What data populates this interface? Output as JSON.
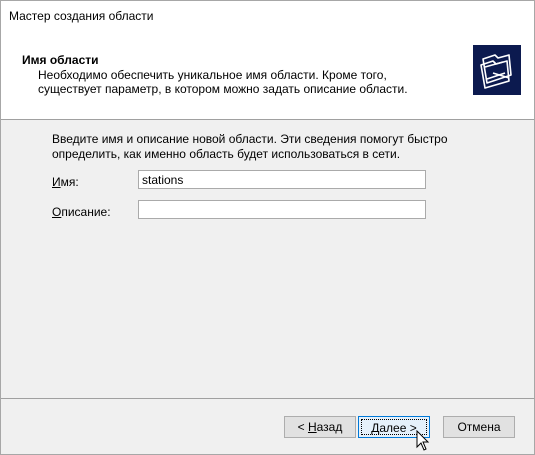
{
  "window": {
    "title": "Мастер создания области"
  },
  "header": {
    "title": "Имя области",
    "description": "Необходимо обеспечить уникальное имя области. Кроме того, существует параметр, в котором можно задать описание области.",
    "icon": "folders-icon",
    "icon_bg": "#0c1a4f"
  },
  "body": {
    "instructions": "Введите имя и описание новой области. Эти сведения помогут быстро определить, как именно область будет использоваться в сети.",
    "name_field": {
      "label_accel": "И",
      "label_rest": "мя:",
      "value": "stations"
    },
    "description_field": {
      "label_accel": "О",
      "label_rest": "писание:",
      "value": ""
    }
  },
  "buttons": {
    "back": {
      "prefix": "< ",
      "accel": "Н",
      "rest": "азад"
    },
    "next": {
      "accel": "Д",
      "rest": "алее >"
    },
    "cancel": {
      "label": "Отмена"
    }
  },
  "colors": {
    "dialog_bg": "#f0f0f0",
    "default_button_border": "#0078d7"
  }
}
